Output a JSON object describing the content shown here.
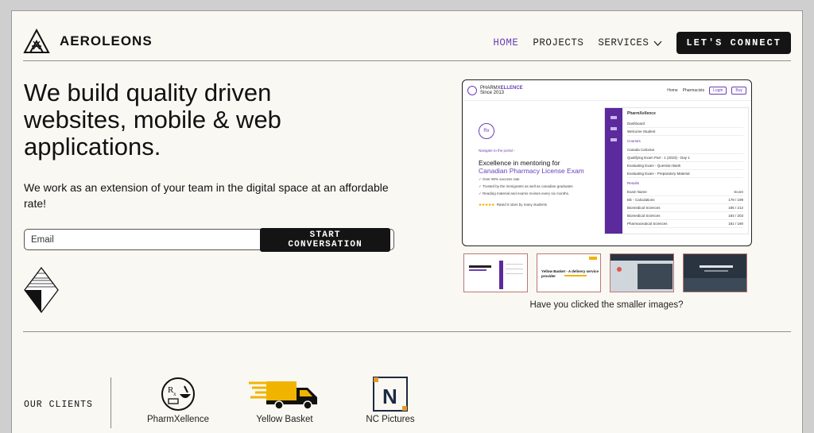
{
  "brand": {
    "name": "AEROLEONS",
    "logo_icon": "mountain-logo-icon"
  },
  "nav": {
    "items": [
      {
        "label": "HOME",
        "active": true
      },
      {
        "label": "PROJECTS",
        "active": false
      },
      {
        "label": "SERVICES",
        "active": false,
        "has_dropdown": true
      }
    ],
    "cta_label": "LET'S CONNECT"
  },
  "hero": {
    "title": "We build quality driven websites, mobile & web applications.",
    "subtitle": "We work as an extension of your team in the digital space at an affordable rate!",
    "email_placeholder": "Email",
    "submit_label": "START CONVERSATION"
  },
  "preview": {
    "brand_line1": "PHARMX",
    "brand_line1b": "ELLENCE",
    "brand_line2": "Since 2013",
    "nav": [
      "Home",
      "Pharmacists",
      "Login",
      "Buy"
    ],
    "rx": "Rx",
    "link": "Navigate to the portal  ›",
    "heading1": "Excellence in mentoring for",
    "heading2": "Canadian Pharmacy License Exam",
    "bullets": [
      "Over 90% success rate",
      "Trusted by the immigrants as well as canadian graduates",
      "Reading material and exams revises every six months."
    ],
    "stars": "★★★★★",
    "rating": "Rated 5 stars by many students",
    "panel_title": "PharmXellence",
    "panel_rows": [
      "Dashboard",
      "Welcome Student"
    ],
    "courses_label": "Courses",
    "course_rows": [
      "Canada Calculus",
      "Qualifying Exam Part - 1 (2023) - Day 1",
      "Evaluating Exam - Question Bank",
      "Evaluating Exam - Preparatory Material"
    ],
    "results_label": "Results",
    "result_rows": [
      {
        "name": "Exam Name",
        "score": "Score"
      },
      {
        "name": "EE - Calculations",
        "score": "178 / 199"
      },
      {
        "name": "Biomedical Sciences",
        "score": "186 / 212"
      },
      {
        "name": "Biomedical Sciences",
        "score": "184 / 203"
      },
      {
        "name": "Pharmaceutical Sciences",
        "score": "181 / 190"
      }
    ],
    "thumb2_text": "Yellow Basket - A delivery service provider"
  },
  "caption": "Have you clicked the smaller images?",
  "clients": {
    "label": "OUR CLIENTS",
    "items": [
      {
        "name": "PharmXellence",
        "icon": "rx-mortar-logo-icon"
      },
      {
        "name": "Yellow Basket",
        "icon": "delivery-truck-logo-icon"
      },
      {
        "name": "NC Pictures",
        "icon": "n-bracket-logo-icon"
      }
    ]
  },
  "colors": {
    "accent": "#6a3fb5",
    "dark": "#141414",
    "background": "#faf8f2",
    "yellow": "#f0b400"
  }
}
